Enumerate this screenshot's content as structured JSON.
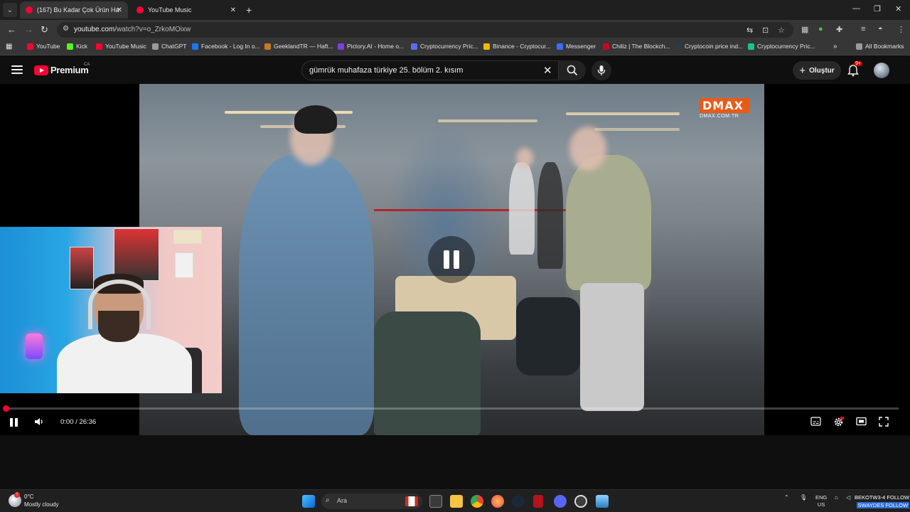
{
  "browser": {
    "tabs": [
      {
        "title": "(167) Bu Kadar Çok Ürün Ha",
        "active": true
      },
      {
        "title": "YouTube Music",
        "active": false
      }
    ],
    "url_domain": "youtube.com",
    "url_path": "/watch?v=o_ZrkoMOixw",
    "bookmarks": [
      {
        "label": "YouTube",
        "color": "#ff0033"
      },
      {
        "label": "Kick",
        "color": "#53fc18"
      },
      {
        "label": "YouTube Music",
        "color": "#ff0033"
      },
      {
        "label": "ChatGPT",
        "color": "#9a9a9a"
      },
      {
        "label": "Facebook - Log In o...",
        "color": "#1877f2"
      },
      {
        "label": "GeeklandTR — Haft...",
        "color": "#c8791f"
      },
      {
        "label": "Pictory.AI - Home o...",
        "color": "#7b3fe4"
      },
      {
        "label": "Cryptocurrency Pric...",
        "color": "#5a6cff"
      },
      {
        "label": "Binance - Cryptocur...",
        "color": "#f0b90b"
      },
      {
        "label": "Messenger",
        "color": "#3a6cff"
      },
      {
        "label": "Chiliz | The Blockch...",
        "color": "#cd0124"
      },
      {
        "label": "Cryptocoin price ind...",
        "color": "#2c3a4a"
      },
      {
        "label": "Cryptocurrency Pric...",
        "color": "#16c784"
      }
    ],
    "all_bookmarks": "All Bookmarks"
  },
  "youtube": {
    "logo_word": "Premium",
    "region": "CA",
    "search_query": "gümrük muhafaza türkiye 25. bölüm 2. kısım",
    "create_label": "Oluştur",
    "notif_badge": "9+"
  },
  "player": {
    "watermark": "DMAX",
    "watermark_sub": "DMAX.COM.TR",
    "current_time": "0:00",
    "duration": "26:36",
    "timecode": "0:00 / 26:36",
    "progress_fraction": 0.0,
    "state": "paused-overlay"
  },
  "taskbar": {
    "weather_temp": "0°C",
    "weather_desc": "Mostly cloudy",
    "search_placeholder": "Ara",
    "lang_line1": "ENG",
    "lang_line2": "US",
    "overlay_line1": "BEKOTW3-4 FOLLOW",
    "overlay_line2": "SWAYDES FOLLOW"
  }
}
